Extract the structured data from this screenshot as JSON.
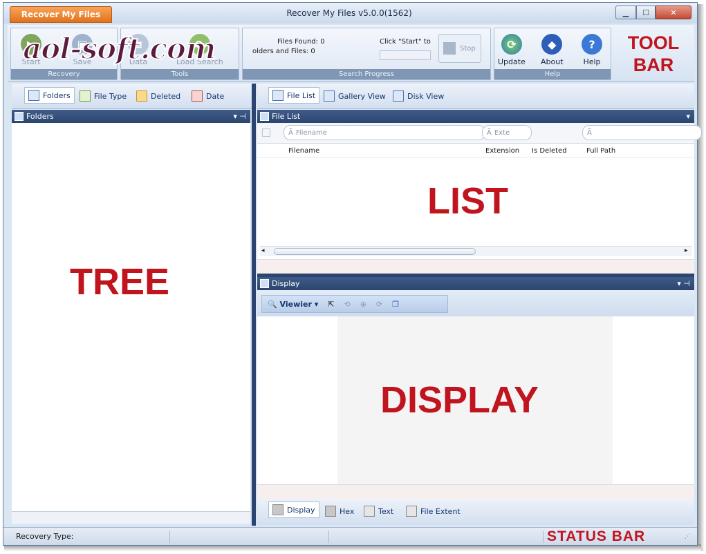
{
  "app": {
    "menu_button": "Recover My Files",
    "title": "Recover My Files v5.0.0(1562)",
    "window_controls": [
      "minimize-icon",
      "maximize-icon",
      "close-icon"
    ]
  },
  "watermark": "aol-soft.com",
  "ribbon": {
    "recovery": {
      "label": "Recovery",
      "buttons": [
        "Start",
        "Save"
      ]
    },
    "tools": {
      "label": "Tools",
      "buttons": [
        "Data",
        "Load Search"
      ]
    },
    "search_progress": {
      "label": "Search Progress",
      "files_found": "Files Found: 0",
      "folders_files": "olders and Files: 0",
      "hint": "Click \"Start\" to",
      "stop": "Stop"
    },
    "help": {
      "label": "Help",
      "buttons": [
        "Update",
        "About",
        "Help"
      ]
    }
  },
  "annotations": {
    "toolbar": "TOOL BAR",
    "tree": "TREE",
    "list": "LIST",
    "display": "DISPLAY",
    "statusbar": "STATUS BAR"
  },
  "left": {
    "tabs": [
      "Folders",
      "File Type",
      "Deleted",
      "Date"
    ],
    "panel_title": "Folders"
  },
  "list": {
    "view_tabs": [
      "File List",
      "Gallery View",
      "Disk View"
    ],
    "panel_title": "File List",
    "filter_placeholders": [
      "Filename",
      "Exte",
      ""
    ],
    "columns": [
      "Filename",
      "Extension",
      "Is Deleted",
      "Full Path"
    ]
  },
  "display": {
    "panel_title": "Display",
    "viewer_button": "Viewier",
    "tabs": [
      "Display",
      "Hex",
      "Text",
      "File Extent"
    ]
  },
  "status": {
    "recovery_type": "Recovery Type:"
  }
}
